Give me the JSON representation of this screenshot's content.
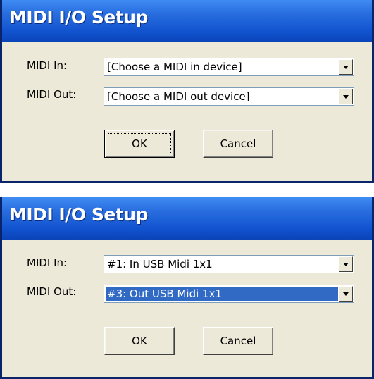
{
  "dialogs": [
    {
      "title": "MIDI I/O Setup",
      "midi_in_label": "MIDI In:",
      "midi_in_value": "[Choose a MIDI in device]",
      "midi_out_label": "MIDI Out:",
      "midi_out_value": "[Choose a MIDI out device]",
      "ok_label": "OK",
      "cancel_label": "Cancel"
    },
    {
      "title": "MIDI I/O Setup",
      "midi_in_label": "MIDI In:",
      "midi_in_value": "#1: In USB Midi 1x1",
      "midi_out_label": "MIDI Out:",
      "midi_out_value": "#3: Out USB Midi 1x1",
      "ok_label": "OK",
      "cancel_label": "Cancel"
    }
  ],
  "icons": {
    "dropdown": "dropdown-arrow-icon"
  },
  "colors": {
    "titlebar": "#2a6fe0",
    "client": "#ece9d8",
    "selection": "#316ac5"
  }
}
